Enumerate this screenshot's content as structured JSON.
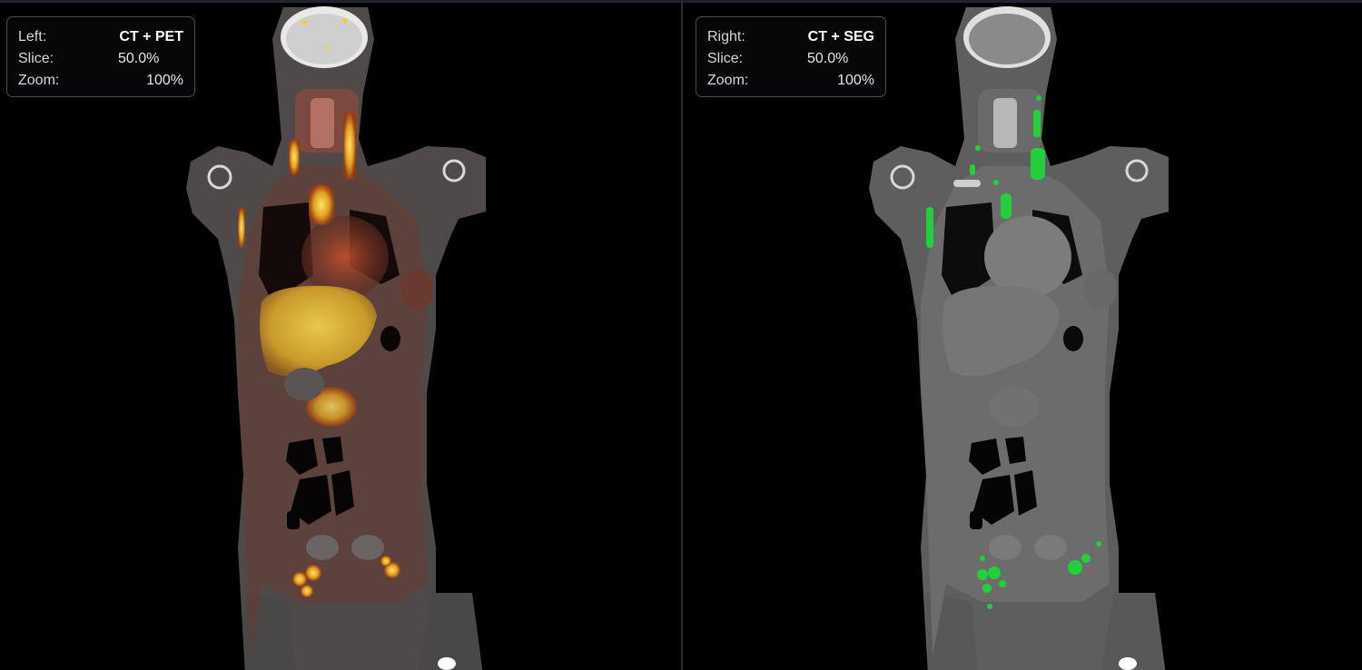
{
  "left_panel": {
    "label": "Left:",
    "mode": "CT + PET",
    "slice_label": "Slice:",
    "slice_value": "50.0%",
    "zoom_label": "Zoom:",
    "zoom_value": "100%"
  },
  "right_panel": {
    "label": "Right:",
    "mode": "CT + SEG",
    "slice_label": "Slice:",
    "slice_value": "50.0%",
    "zoom_label": "Zoom:",
    "zoom_value": "100%"
  },
  "colors": {
    "background": "#000000",
    "pet_hot": "#f0c020",
    "pet_warm": "#b03a1a",
    "segmentation": "#22d13a",
    "ct_tissue": "#6a6a6a"
  }
}
